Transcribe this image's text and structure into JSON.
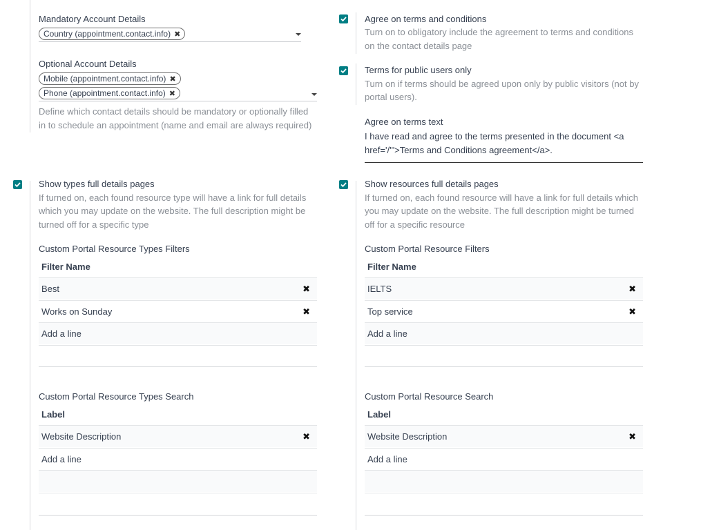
{
  "colors": {
    "accent": "#017e84",
    "muted": "#8a8f96",
    "text": "#374151"
  },
  "left_top": {
    "mandatory_label": "Mandatory Account Details",
    "mandatory_tags": [
      "Country (appointment.contact.info)"
    ],
    "optional_label": "Optional Account Details",
    "optional_tags": [
      "Mobile (appointment.contact.info)",
      "Phone (appointment.contact.info)"
    ],
    "help_line1": "Define which contact details should be mandatory or optionally filled",
    "help_line2": "in to schedule an appointment (name and email are always required)"
  },
  "right_top": {
    "terms": {
      "checked": true,
      "label": "Agree on terms and conditions",
      "help_line1": "Turn on to obligatory include the agreement to terms and conditions",
      "help_line2": "on the contact details page"
    },
    "public_only": {
      "checked": true,
      "label": "Terms for public users only",
      "help_line1": "Turn on if terms should be agreed upon only by public visitors (not by",
      "help_line2": "portal users)."
    },
    "terms_text": {
      "label": "Agree on terms text",
      "line1": "I have read and agree to the terms presented in the document <a",
      "line2": "href='/'\">Terms and Conditions agreement</a>."
    }
  },
  "left_bottom": {
    "setting": {
      "checked": true,
      "label": "Show types full details pages",
      "help_line1": "If turned on, each found resource type will have a link for full details",
      "help_line2": "which you may update on the website. The full description might be",
      "help_line3": "turned off for a specific type"
    },
    "filters": {
      "title": "Custom Portal Resource Types Filters",
      "header": "Filter Name",
      "rows": [
        "Best",
        "Works on Sunday"
      ],
      "add_line": "Add a line"
    },
    "search": {
      "title": "Custom Portal Resource Types Search",
      "header": "Label",
      "rows": [
        "Website Description"
      ],
      "add_line": "Add a line"
    }
  },
  "right_bottom": {
    "setting": {
      "checked": true,
      "label": "Show resources full details pages",
      "help_line1": "If turned on, each found resource will have a link for full details which",
      "help_line2": "you may update on the website. The full description might be turned",
      "help_line3": "off for a specific resource"
    },
    "filters": {
      "title": "Custom Portal Resource Filters",
      "header": "Filter Name",
      "rows": [
        "IELTS",
        "Top service"
      ],
      "add_line": "Add a line"
    },
    "search": {
      "title": "Custom Portal Resource Search",
      "header": "Label",
      "rows": [
        "Website Description"
      ],
      "add_line": "Add a line"
    }
  },
  "icons": {
    "remove_tag": "close-icon",
    "delete_row": "delete-icon",
    "check": "check-icon",
    "dropdown": "caret-down-icon"
  }
}
